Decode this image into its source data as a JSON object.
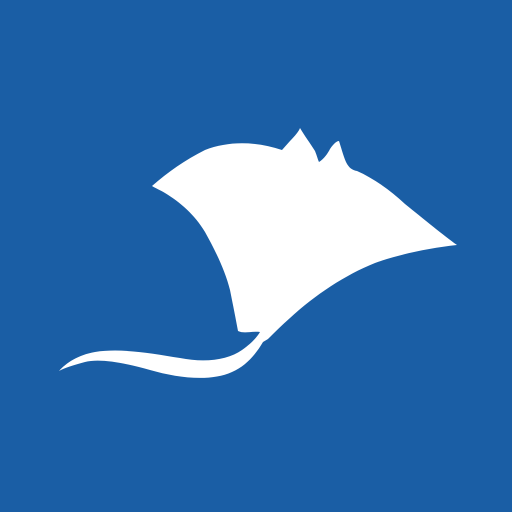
{
  "app_icon": {
    "name": "manta-ray-icon",
    "background_color": "#1A5EA5",
    "foreground_color": "#FFFFFF"
  }
}
